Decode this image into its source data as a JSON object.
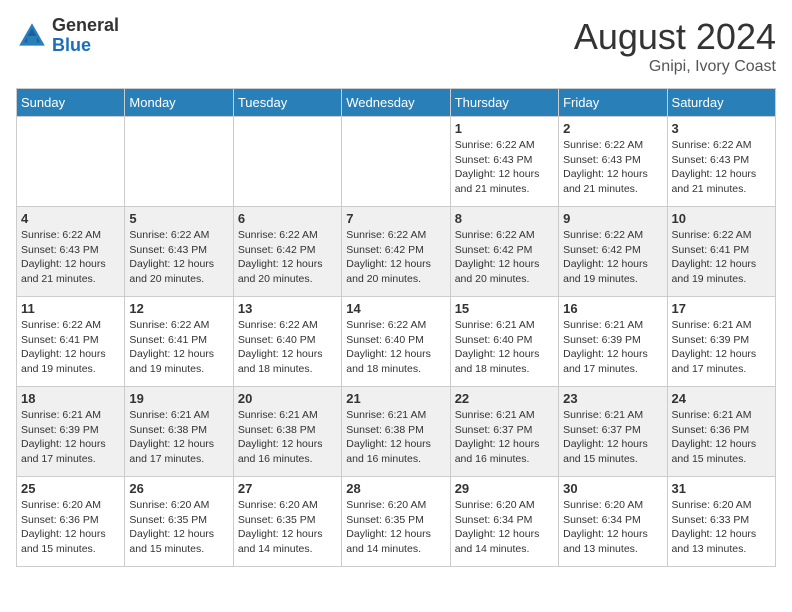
{
  "header": {
    "logo_general": "General",
    "logo_blue": "Blue",
    "month_year": "August 2024",
    "location": "Gnipi, Ivory Coast"
  },
  "days_of_week": [
    "Sunday",
    "Monday",
    "Tuesday",
    "Wednesday",
    "Thursday",
    "Friday",
    "Saturday"
  ],
  "weeks": [
    [
      {
        "day": "",
        "info": ""
      },
      {
        "day": "",
        "info": ""
      },
      {
        "day": "",
        "info": ""
      },
      {
        "day": "",
        "info": ""
      },
      {
        "day": "1",
        "info": "Sunrise: 6:22 AM\nSunset: 6:43 PM\nDaylight: 12 hours and 21 minutes."
      },
      {
        "day": "2",
        "info": "Sunrise: 6:22 AM\nSunset: 6:43 PM\nDaylight: 12 hours and 21 minutes."
      },
      {
        "day": "3",
        "info": "Sunrise: 6:22 AM\nSunset: 6:43 PM\nDaylight: 12 hours and 21 minutes."
      }
    ],
    [
      {
        "day": "4",
        "info": "Sunrise: 6:22 AM\nSunset: 6:43 PM\nDaylight: 12 hours and 21 minutes."
      },
      {
        "day": "5",
        "info": "Sunrise: 6:22 AM\nSunset: 6:43 PM\nDaylight: 12 hours and 20 minutes."
      },
      {
        "day": "6",
        "info": "Sunrise: 6:22 AM\nSunset: 6:42 PM\nDaylight: 12 hours and 20 minutes."
      },
      {
        "day": "7",
        "info": "Sunrise: 6:22 AM\nSunset: 6:42 PM\nDaylight: 12 hours and 20 minutes."
      },
      {
        "day": "8",
        "info": "Sunrise: 6:22 AM\nSunset: 6:42 PM\nDaylight: 12 hours and 20 minutes."
      },
      {
        "day": "9",
        "info": "Sunrise: 6:22 AM\nSunset: 6:42 PM\nDaylight: 12 hours and 19 minutes."
      },
      {
        "day": "10",
        "info": "Sunrise: 6:22 AM\nSunset: 6:41 PM\nDaylight: 12 hours and 19 minutes."
      }
    ],
    [
      {
        "day": "11",
        "info": "Sunrise: 6:22 AM\nSunset: 6:41 PM\nDaylight: 12 hours and 19 minutes."
      },
      {
        "day": "12",
        "info": "Sunrise: 6:22 AM\nSunset: 6:41 PM\nDaylight: 12 hours and 19 minutes."
      },
      {
        "day": "13",
        "info": "Sunrise: 6:22 AM\nSunset: 6:40 PM\nDaylight: 12 hours and 18 minutes."
      },
      {
        "day": "14",
        "info": "Sunrise: 6:22 AM\nSunset: 6:40 PM\nDaylight: 12 hours and 18 minutes."
      },
      {
        "day": "15",
        "info": "Sunrise: 6:21 AM\nSunset: 6:40 PM\nDaylight: 12 hours and 18 minutes."
      },
      {
        "day": "16",
        "info": "Sunrise: 6:21 AM\nSunset: 6:39 PM\nDaylight: 12 hours and 17 minutes."
      },
      {
        "day": "17",
        "info": "Sunrise: 6:21 AM\nSunset: 6:39 PM\nDaylight: 12 hours and 17 minutes."
      }
    ],
    [
      {
        "day": "18",
        "info": "Sunrise: 6:21 AM\nSunset: 6:39 PM\nDaylight: 12 hours and 17 minutes."
      },
      {
        "day": "19",
        "info": "Sunrise: 6:21 AM\nSunset: 6:38 PM\nDaylight: 12 hours and 17 minutes."
      },
      {
        "day": "20",
        "info": "Sunrise: 6:21 AM\nSunset: 6:38 PM\nDaylight: 12 hours and 16 minutes."
      },
      {
        "day": "21",
        "info": "Sunrise: 6:21 AM\nSunset: 6:38 PM\nDaylight: 12 hours and 16 minutes."
      },
      {
        "day": "22",
        "info": "Sunrise: 6:21 AM\nSunset: 6:37 PM\nDaylight: 12 hours and 16 minutes."
      },
      {
        "day": "23",
        "info": "Sunrise: 6:21 AM\nSunset: 6:37 PM\nDaylight: 12 hours and 15 minutes."
      },
      {
        "day": "24",
        "info": "Sunrise: 6:21 AM\nSunset: 6:36 PM\nDaylight: 12 hours and 15 minutes."
      }
    ],
    [
      {
        "day": "25",
        "info": "Sunrise: 6:20 AM\nSunset: 6:36 PM\nDaylight: 12 hours and 15 minutes."
      },
      {
        "day": "26",
        "info": "Sunrise: 6:20 AM\nSunset: 6:35 PM\nDaylight: 12 hours and 15 minutes."
      },
      {
        "day": "27",
        "info": "Sunrise: 6:20 AM\nSunset: 6:35 PM\nDaylight: 12 hours and 14 minutes."
      },
      {
        "day": "28",
        "info": "Sunrise: 6:20 AM\nSunset: 6:35 PM\nDaylight: 12 hours and 14 minutes."
      },
      {
        "day": "29",
        "info": "Sunrise: 6:20 AM\nSunset: 6:34 PM\nDaylight: 12 hours and 14 minutes."
      },
      {
        "day": "30",
        "info": "Sunrise: 6:20 AM\nSunset: 6:34 PM\nDaylight: 12 hours and 13 minutes."
      },
      {
        "day": "31",
        "info": "Sunrise: 6:20 AM\nSunset: 6:33 PM\nDaylight: 12 hours and 13 minutes."
      }
    ]
  ]
}
